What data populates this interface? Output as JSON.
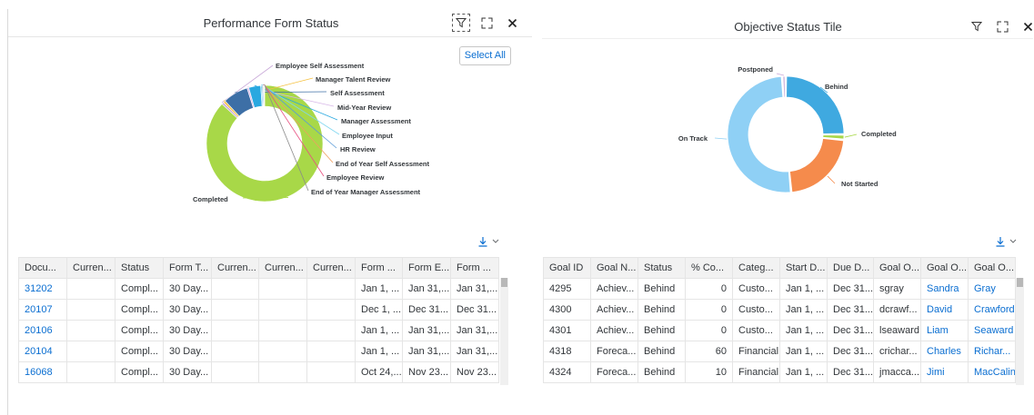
{
  "left_panel": {
    "title": "Performance Form Status",
    "select_all": "Select All",
    "header_icons": [
      "filter-icon",
      "expand-icon",
      "close-icon"
    ],
    "chart_data": {
      "type": "pie",
      "donut": true,
      "slices": [
        {
          "name": "Completed",
          "value": 86.9,
          "color": "#a8d848"
        },
        {
          "name": "Employee Self Assessment",
          "value": 0.6,
          "color": "#c8a8d8"
        },
        {
          "name": "Manager Talent Review",
          "value": 0.6,
          "color": "#f5c242"
        },
        {
          "name": "Self Assessment",
          "value": 7.0,
          "color": "#3d6fa6"
        },
        {
          "name": "Mid-Year Review",
          "value": 0.5,
          "color": "#d8b8e8"
        },
        {
          "name": "Manager Assessment",
          "value": 3.3,
          "color": "#29a8e0"
        },
        {
          "name": "Employee Input",
          "value": 0.4,
          "color": "#7fd6f0"
        },
        {
          "name": "HR Review",
          "value": 0.3,
          "color": "#5a9ad8"
        },
        {
          "name": "End of Year Self Assessment",
          "value": 0.2,
          "color": "#f0a060"
        },
        {
          "name": "Employee Review",
          "value": 0.1,
          "color": "#e85080"
        },
        {
          "name": "End of Year Manager Assessment",
          "value": 0.1,
          "color": "#8a8a8a"
        }
      ]
    },
    "table": {
      "columns": [
        "Docu...",
        "Curren...",
        "Status",
        "Form T...",
        "Curren...",
        "Curren...",
        "Curren...",
        "Form ...",
        "Form E...",
        "Form ..."
      ],
      "rows": [
        [
          "31202",
          "",
          "Compl...",
          "30 Day...",
          "",
          "",
          "",
          "Jan 1, ...",
          "Jan 31,...",
          "Jan 31,..."
        ],
        [
          "20107",
          "",
          "Compl...",
          "30 Day...",
          "",
          "",
          "",
          "Dec 1, ...",
          "Dec 31...",
          "Dec 31..."
        ],
        [
          "20106",
          "",
          "Compl...",
          "30 Day...",
          "",
          "",
          "",
          "Jan 1, ...",
          "Jan 31,...",
          "Jan 31,..."
        ],
        [
          "20104",
          "",
          "Compl...",
          "30 Day...",
          "",
          "",
          "",
          "Jan 1, ...",
          "Jan 31,...",
          "Jan 31,..."
        ],
        [
          "16068",
          "",
          "Compl...",
          "30 Day...",
          "",
          "",
          "",
          "Oct 24,...",
          "Nov 23...",
          "Nov 23..."
        ]
      ]
    }
  },
  "right_panel": {
    "title": "Objective Status Tile",
    "header_icons": [
      "filter-icon",
      "expand-icon",
      "close-icon"
    ],
    "chart_data": {
      "type": "pie",
      "donut": true,
      "slices": [
        {
          "name": "Behind",
          "value": 25,
          "color": "#3fa9e0"
        },
        {
          "name": "Completed",
          "value": 1.5,
          "color": "#a8d848"
        },
        {
          "name": "Not Started",
          "value": 22,
          "color": "#f58b4c"
        },
        {
          "name": "On Track",
          "value": 50.5,
          "color": "#8fd0f5"
        },
        {
          "name": "Postponed",
          "value": 1,
          "color": "#c8a8d8"
        }
      ]
    },
    "table": {
      "columns": [
        "Goal ID",
        "Goal N...",
        "Status",
        "% Co...",
        "Categ...",
        "Start D...",
        "Due D...",
        "Goal O...",
        "Goal O...",
        "Goal O..."
      ],
      "rows": [
        [
          "4295",
          "Achiev...",
          "Behind",
          "0",
          "Custo...",
          "Jan 1, ...",
          "Dec 31...",
          "sgray",
          "Sandra",
          "Gray"
        ],
        [
          "4300",
          "Achiev...",
          "Behind",
          "0",
          "Custo...",
          "Jan 1, ...",
          "Dec 31...",
          "dcrawf...",
          "David",
          "Crawford"
        ],
        [
          "4301",
          "Achiev...",
          "Behind",
          "0",
          "Custo...",
          "Jan 1, ...",
          "Dec 31...",
          "lseaward",
          "Liam",
          "Seaward"
        ],
        [
          "4318",
          "Foreca...",
          "Behind",
          "60",
          "Financial",
          "Jan 1, ...",
          "Dec 31...",
          "crichar...",
          "Charles",
          "Richar..."
        ],
        [
          "4324",
          "Foreca...",
          "Behind",
          "10",
          "Financial",
          "Jan 1, ...",
          "Dec 31...",
          "jmacca...",
          "Jimi",
          "MacCalin"
        ]
      ]
    }
  }
}
